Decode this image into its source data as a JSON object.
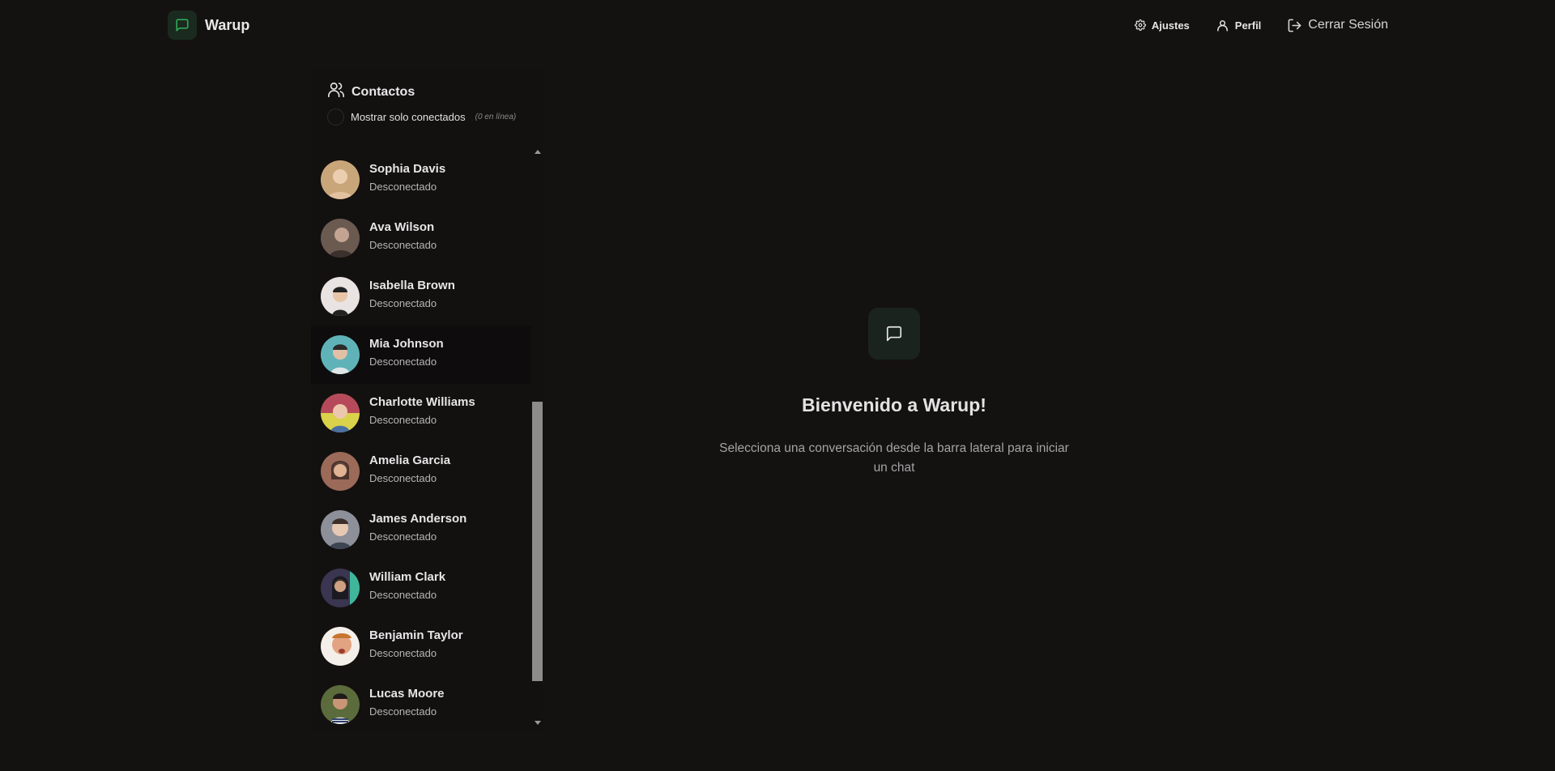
{
  "header": {
    "app_name": "Warup",
    "nav": {
      "settings_label": "Ajustes",
      "profile_label": "Perfil",
      "logout_label": "Cerrar Sesión"
    }
  },
  "sidebar": {
    "title": "Contactos",
    "filter_label": "Mostrar solo conectados",
    "filter_count": "(0 en línea)",
    "contacts": [
      {
        "name": "Sophia Davis",
        "status": "Desconectado",
        "avatar_color": "#c9a67a"
      },
      {
        "name": "Ava Wilson",
        "status": "Desconectado",
        "avatar_color": "#6b5a50"
      },
      {
        "name": "Isabella Brown",
        "status": "Desconectado",
        "avatar_color": "#e9e4e1"
      },
      {
        "name": "Mia Johnson",
        "status": "Desconectado",
        "avatar_color": "#5fb3b8"
      },
      {
        "name": "Charlotte Williams",
        "status": "Desconectado",
        "avatar_color": "#b64a5a"
      },
      {
        "name": "Amelia Garcia",
        "status": "Desconectado",
        "avatar_color": "#9b6a58"
      },
      {
        "name": "James Anderson",
        "status": "Desconectado",
        "avatar_color": "#8d8f99"
      },
      {
        "name": "William Clark",
        "status": "Desconectado",
        "avatar_color": "#3a3550"
      },
      {
        "name": "Benjamin Taylor",
        "status": "Desconectado",
        "avatar_color": "#e2a383"
      },
      {
        "name": "Lucas Moore",
        "status": "Desconectado",
        "avatar_color": "#5b6b3c"
      }
    ]
  },
  "welcome": {
    "title": "Bienvenido a Warup!",
    "subtitle": "Selecciona una conversación desde la barra lateral para iniciar un chat"
  },
  "colors": {
    "background": "#141111",
    "accent_green": "#2fb15a",
    "scroll_thumb": "#8e8b8b"
  },
  "icons": {
    "brand": "message-square-icon",
    "settings": "gear-icon",
    "profile": "user-icon",
    "logout": "log-out-icon",
    "contacts": "users-icon",
    "welcome": "message-square-icon"
  }
}
